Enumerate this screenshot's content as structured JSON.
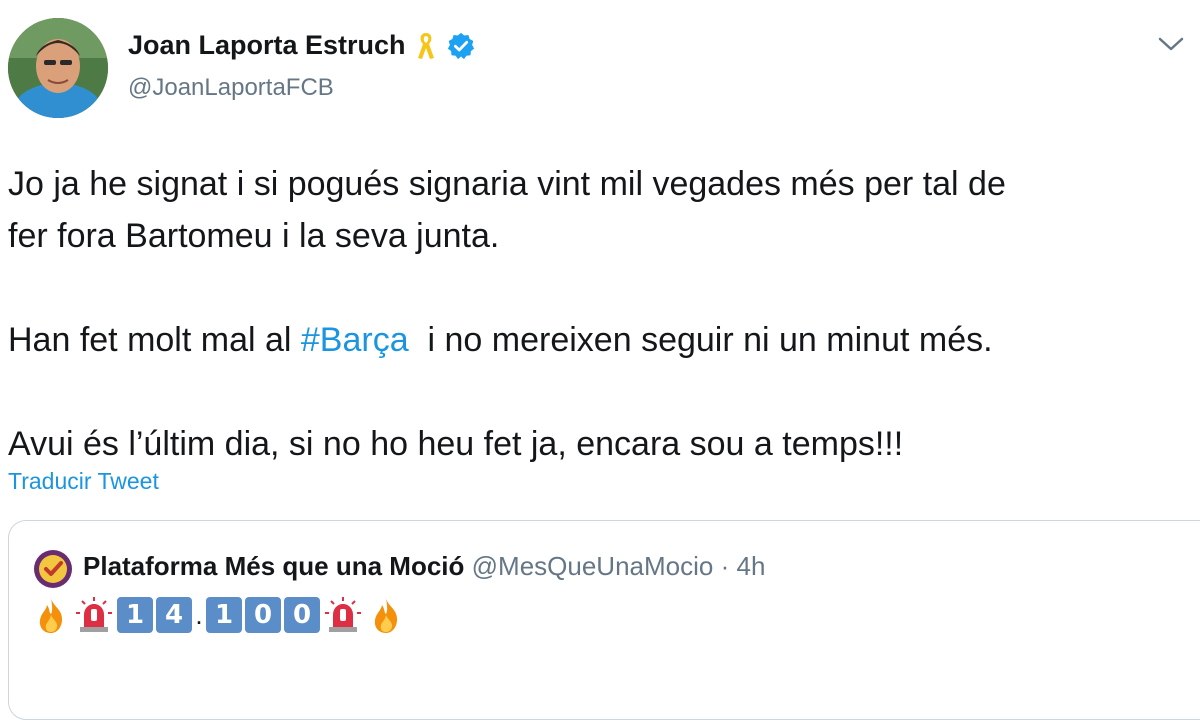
{
  "author": {
    "display_name": "Joan Laporta Estruch",
    "handle": "@JoanLaportaFCB",
    "ribbon_icon": "yellow-ribbon",
    "verified_icon": "verified-badge",
    "verified_color": "#1da1f2"
  },
  "tweet": {
    "line1a": "Jo ja he signat i si pogués signaria vint mil vegades més per tal de",
    "line1b": "fer fora Bartomeu i la seva junta.",
    "line2_before": "Han fet molt mal al ",
    "hashtag": "#Barça",
    "line2_after": "  i no mereixen seguir ni un minut més.",
    "line3": "Avui és l’últim dia, si no ho heu fet ja, encara sou a temps!!!",
    "translate_label": "Traducir Tweet"
  },
  "quoted": {
    "display_name": "Plataforma Més que una Moció",
    "handle": "@MesQueUnaMocio",
    "separator": "·",
    "time": "4h",
    "keycaps": [
      "1",
      "4",
      ".",
      "1",
      "0",
      "0"
    ]
  },
  "colors": {
    "link": "#1b95e0",
    "secondary_text": "#657786",
    "border": "#ccd6dd"
  }
}
